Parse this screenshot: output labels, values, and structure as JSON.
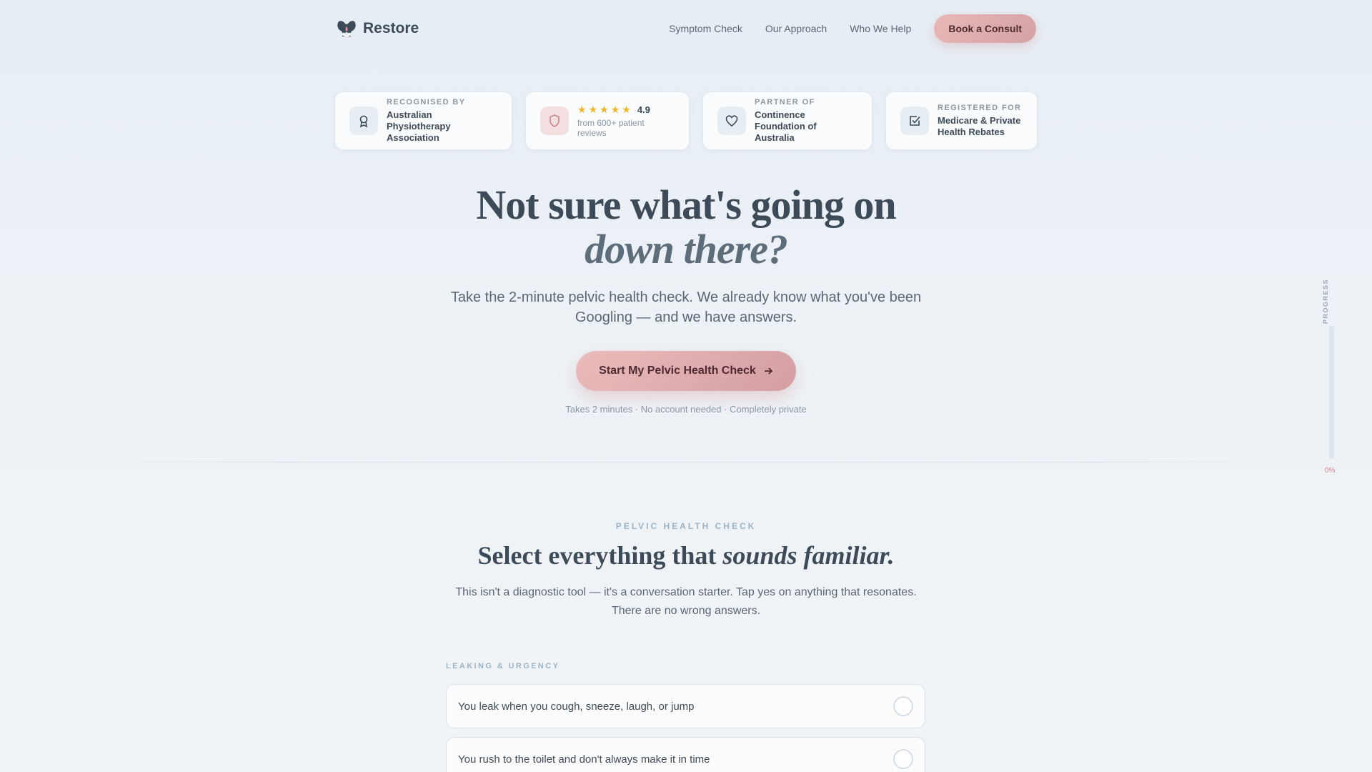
{
  "nav": {
    "brand": "Restore",
    "links": [
      "Symptom Check",
      "Our Approach",
      "Who We Help"
    ],
    "cta": "Book a Consult"
  },
  "badges": [
    {
      "kicker": "RECOGNISED BY",
      "title": "Australian Physiotherapy Association",
      "icon": "award-icon"
    },
    {
      "rating": "4.9",
      "stars": 5,
      "sub": "from 600+ patient reviews",
      "icon": "shield-icon"
    },
    {
      "kicker": "PARTNER OF",
      "title": "Continence Foundation of Australia",
      "icon": "heart-icon"
    },
    {
      "kicker": "REGISTERED FOR",
      "title": "Medicare & Private Health Rebates",
      "icon": "checkbox-icon"
    }
  ],
  "hero": {
    "title_line1": "Not sure what's going on",
    "title_line2": "down there?",
    "subtitle": "Take the 2-minute pelvic health check. We already know what you've been Googling — and we have answers.",
    "cta": "Start My Pelvic Health Check",
    "note": "Takes 2 minutes · No account needed · Completely private"
  },
  "progress": {
    "label": "PROGRESS",
    "percent_text": "0%",
    "value": 0
  },
  "quiz": {
    "kicker": "PELVIC HEALTH CHECK",
    "title_plain": "Select everything that ",
    "title_italic": "sounds familiar.",
    "description": "This isn't a diagnostic tool — it's a conversation starter. Tap yes on anything that resonates. There are no wrong answers.",
    "group_label": "LEAKING & URGENCY",
    "options": [
      "You leak when you cough, sneeze, laugh, or jump",
      "You rush to the toilet and don't always make it in time"
    ]
  },
  "colors": {
    "accent_pink": "#d39ea3",
    "text_dark": "#3d4b58",
    "star": "#f0b429"
  }
}
